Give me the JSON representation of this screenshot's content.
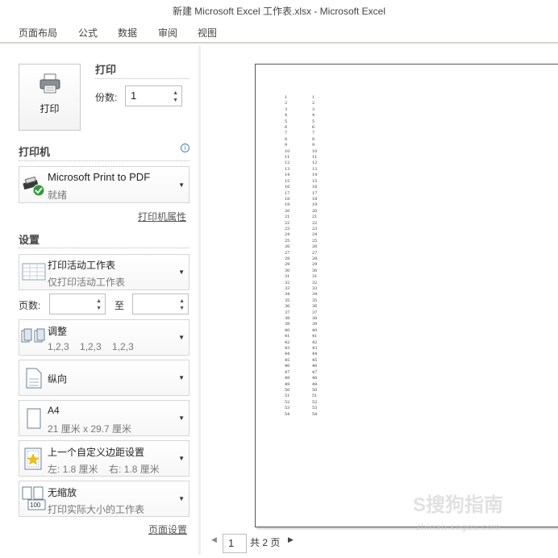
{
  "window": {
    "title": "新建 Microsoft Excel 工作表.xlsx - Microsoft Excel"
  },
  "ribbon_tabs": [
    "页面布局",
    "公式",
    "数据",
    "审阅",
    "视图"
  ],
  "print": {
    "heading": "打印",
    "button_label": "打印",
    "copies_label": "份数:",
    "copies_value": "1"
  },
  "printer": {
    "heading": "打印机",
    "name": "Microsoft Print to PDF",
    "status": "就绪",
    "properties_link": "打印机属性"
  },
  "settings": {
    "heading": "设置",
    "print_what": {
      "title": "打印活动工作表",
      "subtitle": "仅打印活动工作表"
    },
    "pages_label": "页数:",
    "pages_to": "至",
    "collate": {
      "title": "调整",
      "subtitle": "1,2,3    1,2,3    1,2,3"
    },
    "orientation": {
      "title": "纵向"
    },
    "paper": {
      "title": "A4",
      "subtitle": "21 厘米 x 29.7 厘米"
    },
    "margins": {
      "title": "上一个自定义边距设置",
      "subtitle": "左: 1.8 厘米    右: 1.8 厘米"
    },
    "scaling": {
      "title": "无缩放",
      "subtitle": "打印实际大小的工作表",
      "icon_text": "100"
    },
    "page_setup_link": "页面设置"
  },
  "preview": {
    "column_values": [
      "1",
      "2",
      "3",
      "4",
      "5",
      "6",
      "7",
      "8",
      "9",
      "10",
      "11",
      "12",
      "13",
      "14",
      "15",
      "16",
      "17",
      "18",
      "19",
      "20",
      "21",
      "22",
      "23",
      "24",
      "25",
      "26",
      "27",
      "28",
      "29",
      "30",
      "31",
      "32",
      "33",
      "34",
      "35",
      "36",
      "37",
      "38",
      "39",
      "40",
      "41",
      "42",
      "43",
      "44",
      "45",
      "46",
      "47",
      "48",
      "49",
      "50",
      "51",
      "52",
      "53",
      "54"
    ],
    "current_page": "1",
    "total_pages": "共 2 页"
  },
  "watermark": {
    "text": "S搜狗指南",
    "sub": "zhinan.sogou.com"
  },
  "colors": {
    "check_green": "#2e9b3a",
    "ribbon_line": "#d0d8c8"
  }
}
